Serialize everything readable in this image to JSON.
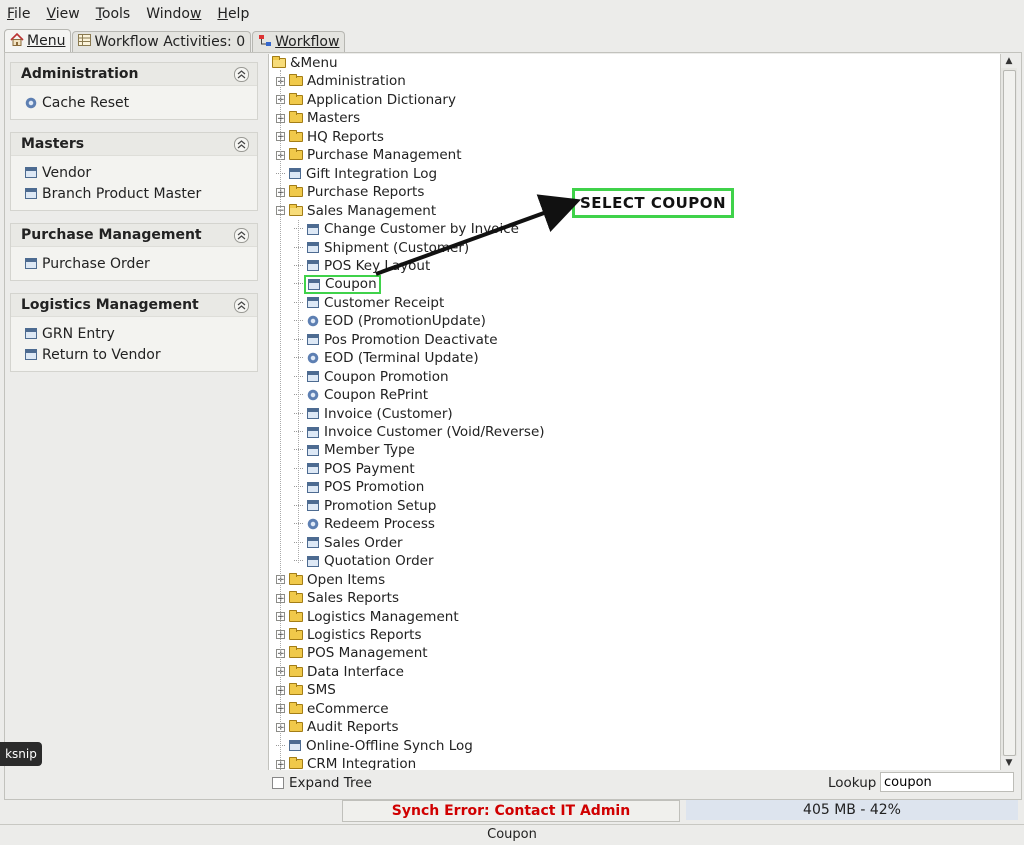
{
  "menubar": [
    {
      "prefix": "",
      "ul": "F",
      "rest": "ile"
    },
    {
      "prefix": "",
      "ul": "V",
      "rest": "iew"
    },
    {
      "prefix": "",
      "ul": "T",
      "rest": "ools"
    },
    {
      "prefix": "Windo",
      "ul": "w",
      "rest": ""
    },
    {
      "prefix": "",
      "ul": "H",
      "rest": "elp"
    }
  ],
  "tabs": {
    "menu": "Menu",
    "workflow_activities": "Workflow Activities: 0",
    "workflow": "Workflow"
  },
  "panels": [
    {
      "title": "Administration",
      "items": [
        {
          "label": "Cache Reset",
          "icon": "gear-icon"
        }
      ]
    },
    {
      "title": "Masters",
      "items": [
        {
          "label": "Vendor",
          "icon": "window-icon"
        },
        {
          "label": "Branch Product Master",
          "icon": "window-icon"
        }
      ]
    },
    {
      "title": "Purchase Management",
      "items": [
        {
          "label": "Purchase Order",
          "icon": "window-icon"
        }
      ]
    },
    {
      "title": "Logistics Management",
      "items": [
        {
          "label": "GRN Entry",
          "icon": "window-icon"
        },
        {
          "label": "Return to Vendor",
          "icon": "window-icon"
        }
      ]
    }
  ],
  "tree": {
    "root": "&Menu",
    "top_items": [
      {
        "label": "Administration",
        "type": "folder"
      },
      {
        "label": "Application Dictionary",
        "type": "folder"
      },
      {
        "label": "Masters",
        "type": "folder"
      },
      {
        "label": "HQ Reports",
        "type": "folder"
      },
      {
        "label": "Purchase Management",
        "type": "folder"
      },
      {
        "label": "Gift Integration Log",
        "type": "window"
      },
      {
        "label": "Purchase Reports",
        "type": "folder"
      },
      {
        "label": "Sales Management",
        "type": "folder-open"
      }
    ],
    "sales_children": [
      {
        "label": "Change Customer by Invoice",
        "type": "window"
      },
      {
        "label": "Shipment (Customer)",
        "type": "window"
      },
      {
        "label": "POS Key Layout",
        "type": "window"
      },
      {
        "label": "Coupon",
        "type": "window",
        "highlighted": true
      },
      {
        "label": "Customer Receipt",
        "type": "window"
      },
      {
        "label": "EOD (PromotionUpdate)",
        "type": "gear"
      },
      {
        "label": "Pos Promotion Deactivate",
        "type": "window"
      },
      {
        "label": "EOD (Terminal Update)",
        "type": "gear"
      },
      {
        "label": "Coupon Promotion",
        "type": "window"
      },
      {
        "label": "Coupon RePrint",
        "type": "gear"
      },
      {
        "label": "Invoice (Customer)",
        "type": "window"
      },
      {
        "label": "Invoice Customer (Void/Reverse)",
        "type": "window"
      },
      {
        "label": "Member Type",
        "type": "window"
      },
      {
        "label": "POS Payment",
        "type": "window"
      },
      {
        "label": "POS Promotion",
        "type": "window"
      },
      {
        "label": "Promotion Setup",
        "type": "window"
      },
      {
        "label": "Redeem Process",
        "type": "gear"
      },
      {
        "label": "Sales Order",
        "type": "window"
      },
      {
        "label": "Quotation Order",
        "type": "window"
      }
    ],
    "bottom_items": [
      {
        "label": "Open Items",
        "type": "folder"
      },
      {
        "label": "Sales Reports",
        "type": "folder"
      },
      {
        "label": "Logistics Management",
        "type": "folder"
      },
      {
        "label": "Logistics Reports",
        "type": "folder"
      },
      {
        "label": "POS Management",
        "type": "folder"
      },
      {
        "label": "Data Interface",
        "type": "folder"
      },
      {
        "label": "SMS",
        "type": "folder"
      },
      {
        "label": "eCommerce",
        "type": "folder"
      },
      {
        "label": "Audit Reports",
        "type": "folder"
      },
      {
        "label": "Online-Offline Synch Log",
        "type": "window"
      },
      {
        "label": "CRM Integration",
        "type": "folder"
      }
    ]
  },
  "annotation": {
    "callout_text": "SELECT COUPON",
    "color": "#3fd24a"
  },
  "bottom": {
    "expand_tree": "Expand Tree",
    "lookup_label": "Lookup",
    "lookup_value": "coupon"
  },
  "status": {
    "synch_error": "Synch Error: Contact IT Admin",
    "memory": "405 MB - 42%"
  },
  "footer": {
    "text": "Coupon"
  },
  "overlay": {
    "ksnip": "ksnip"
  }
}
